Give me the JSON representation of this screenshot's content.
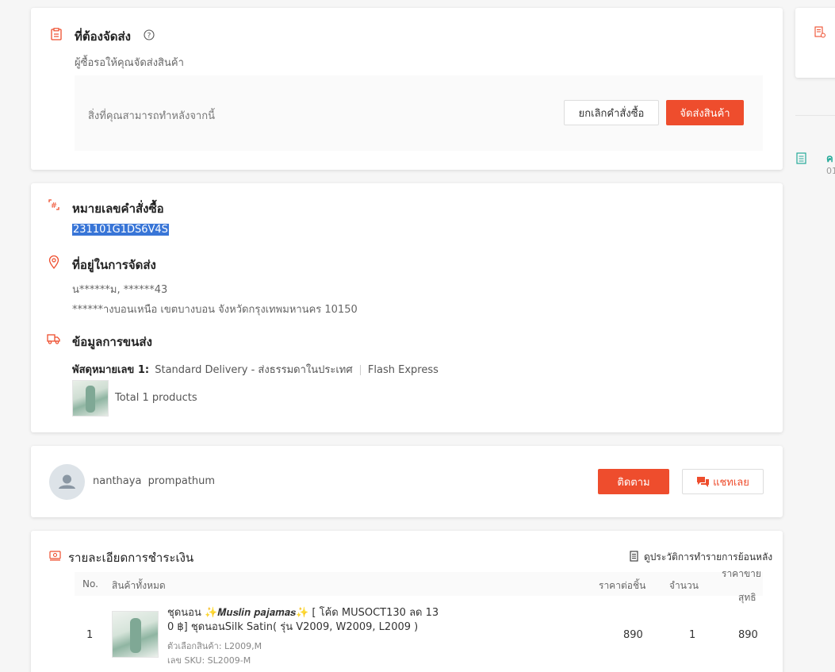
{
  "to_ship": {
    "title": "ที่ต้องจัดส่ง",
    "subtitle": "ผู้ซื้อรอให้คุณจัดส่งสินค้า",
    "actions_hint": "สิ่งที่คุณสามารถทำหลังจากนี้",
    "cancel_label": "ยกเลิกคำสั่งซื้อ",
    "ship_label": "จัดส่งสินค้า"
  },
  "order": {
    "number_title": "หมายเลขคำสั่งซื้อ",
    "number": "231101G1DS6V4S",
    "address_title": "ที่อยู่ในการจัดส่ง",
    "address_line1": "น******ม, ******43",
    "address_line2": "******างบอนเหนือ เขตบางบอน จังหวัดกรุงเทพมหานคร 10150",
    "shipping_title": "ข้อมูลการขนส่ง",
    "parcel_label": "พัสดุหมายเลข 1:",
    "parcel_service": "Standard Delivery - ส่งธรรมดาในประเทศ",
    "parcel_carrier": "Flash Express",
    "total_products": "Total 1 products"
  },
  "buyer": {
    "name": "nanthaya  prompathum",
    "follow_label": "ติดตาม",
    "chat_label": "แชทเลย"
  },
  "payment": {
    "title": "รายละเอียดการชำระเงิน",
    "history_link": "ดูประวัติการทำรายการย้อนหลัง",
    "columns": {
      "no": "No.",
      "product": "สินค้าทั้งหมด",
      "unit_price": "ราคาต่อชิ้น",
      "qty": "จำนวน",
      "net_price_1": "ราคาขาย",
      "net_price_2": "สุทธิ"
    },
    "rows": [
      {
        "no": "1",
        "name_1": "ชุดนอน ✨𝑴𝒖𝒔𝒍𝒊𝒏 𝒑𝒂𝒋𝒂𝒎𝒂𝒔✨ [ โค้ด MUSOCT130 ลด 13",
        "name_2": "0 ฿] ชุดนอนSilk Satin( รุ่น V2009, W2009, L2009 )",
        "variation": "ตัวเลือกสินค้า: L2009,M",
        "sku": "เลข SKU: SL2009-M",
        "unit_price": "890",
        "qty": "1",
        "net_price": "890"
      }
    ]
  },
  "side": {
    "item_label": "ค",
    "item_sub": "01"
  },
  "colors": {
    "accent": "#ee4d2d",
    "highlight": "#3875d7",
    "teal": "#26aa99"
  }
}
